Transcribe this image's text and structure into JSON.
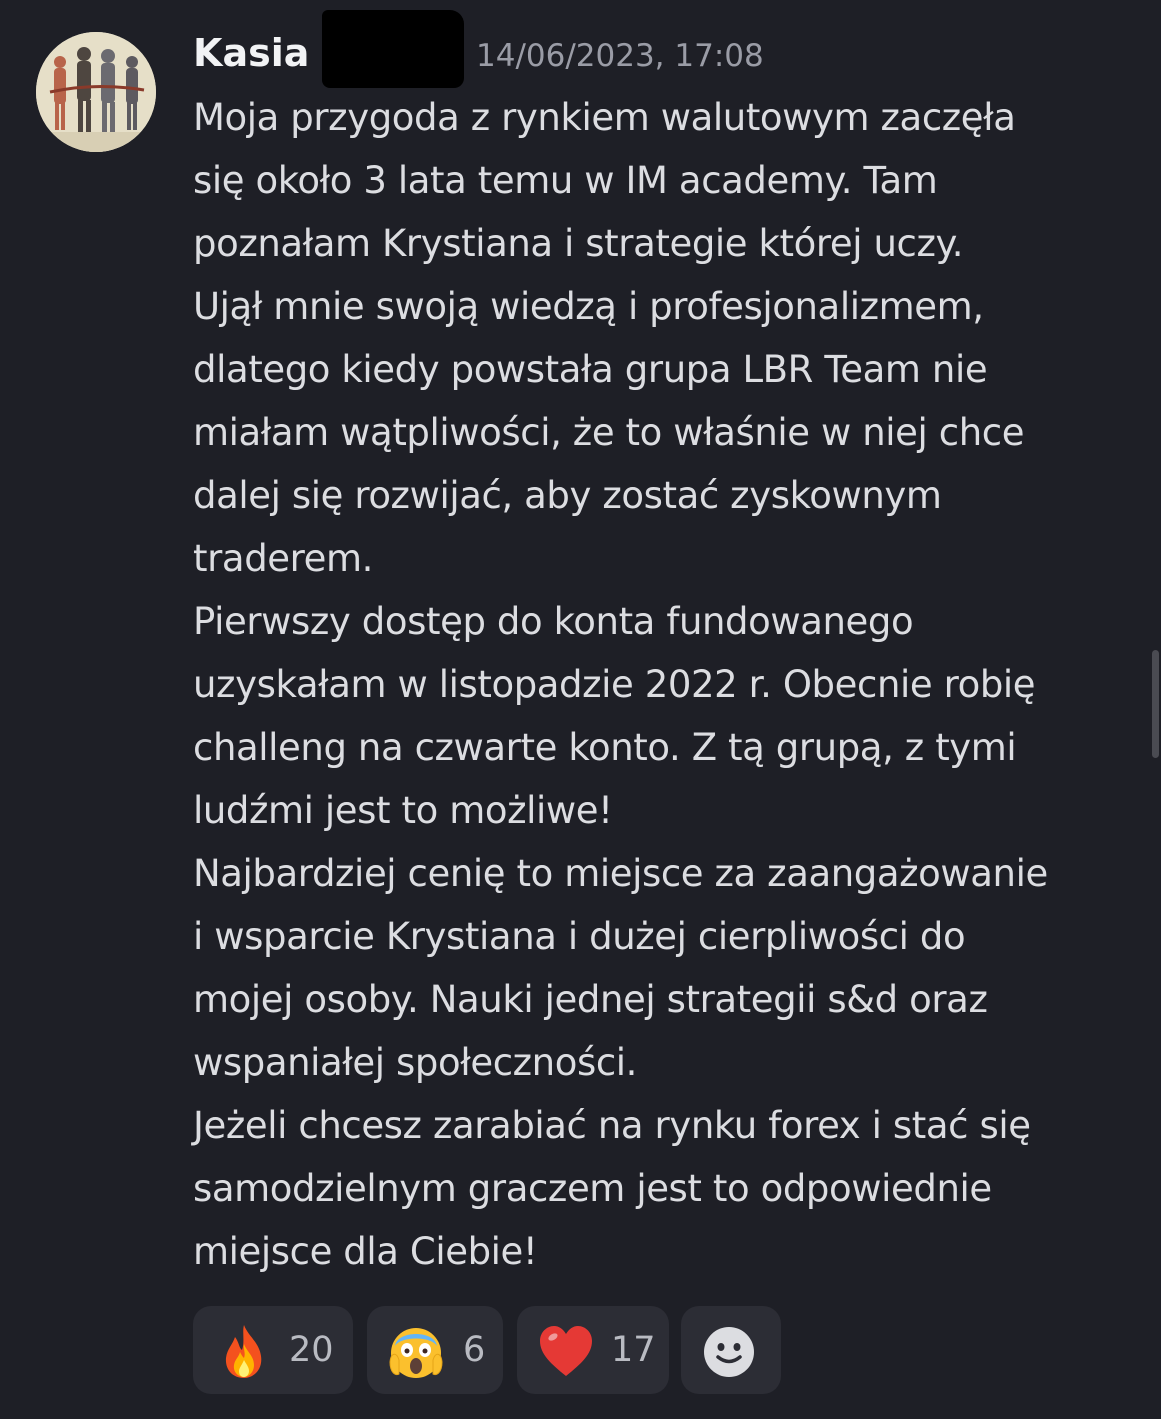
{
  "message": {
    "author": "Kasia B",
    "timestamp": "14/06/2023, 17:08",
    "lines": [
      "Moja przygoda z rynkiem walutowym zaczęła",
      "się około 3 lata temu w IM academy. Tam",
      "poznałam Krystiana i strategie której uczy.",
      "Ujął mnie swoją wiedzą i profesjonalizmem,",
      "dlatego kiedy powstała grupa LBR Team nie",
      "miałam wątpliwości, że to właśnie w niej chce",
      "dalej się rozwijać, aby zostać zyskownym",
      "traderem.",
      "Pierwszy dostęp do konta fundowanego",
      "uzyskałam w listopadzie 2022 r. Obecnie robię",
      "challeng na czwarte konto. Z tą grupą, z tymi",
      "ludźmi jest to możliwe!",
      "Najbardziej cenię to miejsce za zaangażowanie",
      "i wsparcie Krystiana i dużej cierpliwości do",
      "mojej osoby. Nauki jednej strategii s&d oraz",
      "wspaniałej społeczności.",
      "Jeżeli chcesz zarabiać na rynku forex i stać się",
      "samodzielnym graczem jest to odpowiednie",
      "miejsce dla Ciebie!"
    ]
  },
  "reactions": [
    {
      "emoji": "fire-icon",
      "count": "20"
    },
    {
      "emoji": "screaming-face-icon",
      "count": "6"
    },
    {
      "emoji": "red-heart-icon",
      "count": "17"
    },
    {
      "emoji": "add-reaction-icon",
      "count": ""
    }
  ],
  "colors": {
    "background": "#1e1f26",
    "text": "#dcdde1",
    "author": "#f2f3f5",
    "timestamp": "#9a9ca6",
    "reaction_bg": "#2c2d35"
  }
}
